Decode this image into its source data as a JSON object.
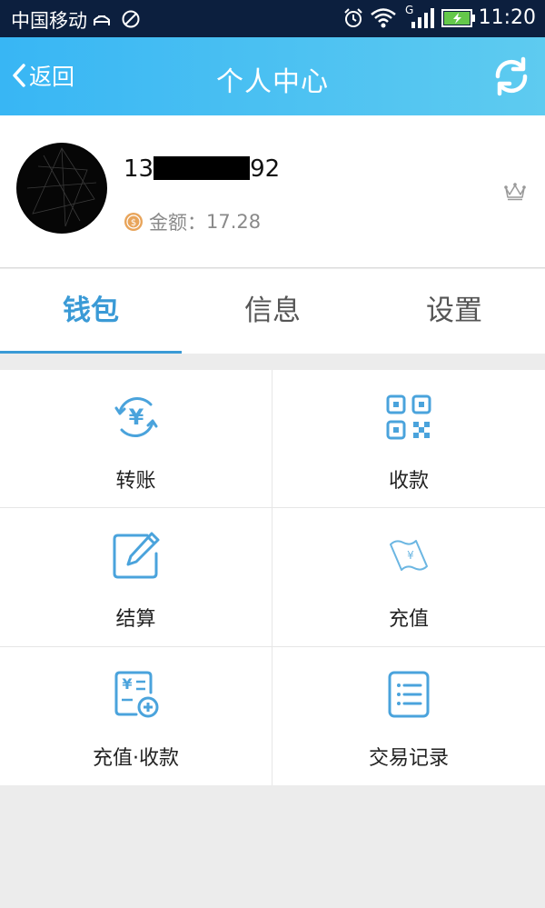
{
  "status_bar": {
    "carrier": "中国移动",
    "time": "11:20",
    "signal_tag": "G"
  },
  "nav": {
    "back_label": "返回",
    "title": "个人中心"
  },
  "profile": {
    "phone_prefix": "13",
    "phone_suffix": "92",
    "balance_label": "金额：",
    "balance_value": "17.28"
  },
  "tabs": [
    {
      "label": "钱包",
      "active": true
    },
    {
      "label": "信息",
      "active": false
    },
    {
      "label": "设置",
      "active": false
    }
  ],
  "grid": [
    {
      "label": "转账",
      "icon": "transfer-icon"
    },
    {
      "label": "收款",
      "icon": "qr-code-icon"
    },
    {
      "label": "结算",
      "icon": "edit-icon"
    },
    {
      "label": "充值",
      "icon": "recharge-icon"
    },
    {
      "label": "充值·收款",
      "icon": "recharge-receive-icon"
    },
    {
      "label": "交易记录",
      "icon": "list-icon"
    }
  ],
  "colors": {
    "status_bar": "#0c1f3e",
    "nav_gradient_start": "#38b6f4",
    "nav_gradient_end": "#5ecbf0",
    "accent": "#3a9ad6",
    "icon_blue": "#4aa3dc",
    "coin": "#e8a45a"
  }
}
